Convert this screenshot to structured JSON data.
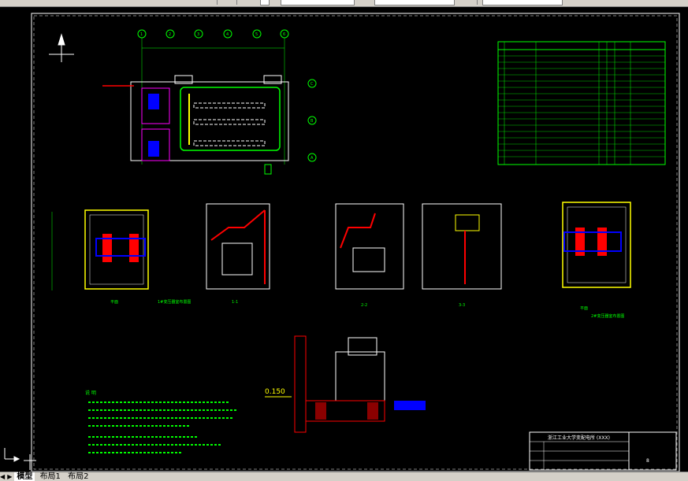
{
  "tabs": {
    "items": [
      "模型",
      "布局1",
      "布局2"
    ],
    "active": 0,
    "nav_left": "◀",
    "nav_right": "▶"
  },
  "drawing": {
    "axis_labels_top": [
      "1",
      "2",
      "3",
      "4",
      "5",
      "6"
    ],
    "axis_labels_side": [
      "C",
      "B",
      "A"
    ],
    "elevation_label": "0.150",
    "views": [
      "平面",
      "1#变压器室布置图",
      "1-1",
      "2-2",
      "3-3",
      "平面",
      "2#变压器室布置图"
    ],
    "title_block": {
      "project": "浙江工业大学变配电所 (XXX)",
      "sheet": "8"
    },
    "notes_title": "说 明",
    "accent_green": "#00ff00",
    "accent_red": "#ff0000",
    "accent_blue": "#0000ff"
  }
}
